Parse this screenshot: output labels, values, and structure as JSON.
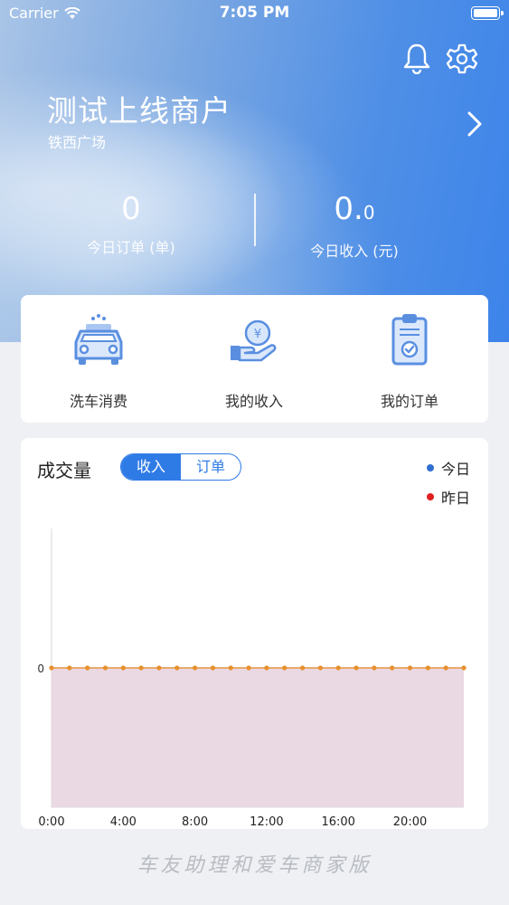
{
  "status_bar": {
    "carrier": "Carrier",
    "time": "7:05 PM"
  },
  "header": {
    "icons": {
      "notify": "bell-icon",
      "settings": "gear-icon",
      "chevron": "chevron-right-icon"
    },
    "merchant_name": "测试上线商户",
    "location": "铁西广场"
  },
  "stats": {
    "orders": {
      "value": "0",
      "label": "今日订单 (单)"
    },
    "income": {
      "value_int": "0.",
      "value_dec": "0",
      "label": "今日收入 (元)"
    }
  },
  "actions": [
    {
      "label": "洗车消费",
      "icon": "car-wash-icon"
    },
    {
      "label": "我的收入",
      "icon": "hand-coin-icon"
    },
    {
      "label": "我的订单",
      "icon": "clipboard-check-icon"
    }
  ],
  "chart_card": {
    "title": "成交量",
    "tabs": [
      "收入",
      "订单"
    ],
    "active_tab": "收入",
    "legend": [
      {
        "label": "今日",
        "color": "#2f6fd0"
      },
      {
        "label": "昨日",
        "color": "#e02020"
      }
    ]
  },
  "chart_data": {
    "type": "line",
    "x": [
      "0:00",
      "1:00",
      "2:00",
      "3:00",
      "4:00",
      "5:00",
      "6:00",
      "7:00",
      "8:00",
      "9:00",
      "10:00",
      "11:00",
      "12:00",
      "13:00",
      "14:00",
      "15:00",
      "16:00",
      "17:00",
      "18:00",
      "19:00",
      "20:00",
      "21:00",
      "22:00",
      "23:00"
    ],
    "x_tick_labels": [
      "0:00",
      "4:00",
      "8:00",
      "12:00",
      "16:00",
      "20:00"
    ],
    "y_tick_labels": [
      "0"
    ],
    "series": [
      {
        "name": "今日",
        "values": [
          0,
          0,
          0,
          0,
          0,
          0,
          0,
          0,
          0,
          0,
          0,
          0,
          0,
          0,
          0,
          0,
          0,
          0,
          0,
          0,
          0,
          0,
          0,
          0
        ]
      },
      {
        "name": "昨日",
        "values": [
          0,
          0,
          0,
          0,
          0,
          0,
          0,
          0,
          0,
          0,
          0,
          0,
          0,
          0,
          0,
          0,
          0,
          0,
          0,
          0,
          0,
          0,
          0,
          0
        ]
      }
    ],
    "colors": {
      "line": "#e8a15a",
      "point": "#e8902e",
      "fill": "#ead8e2"
    }
  },
  "footer_text": "车友助理和爱车商家版"
}
